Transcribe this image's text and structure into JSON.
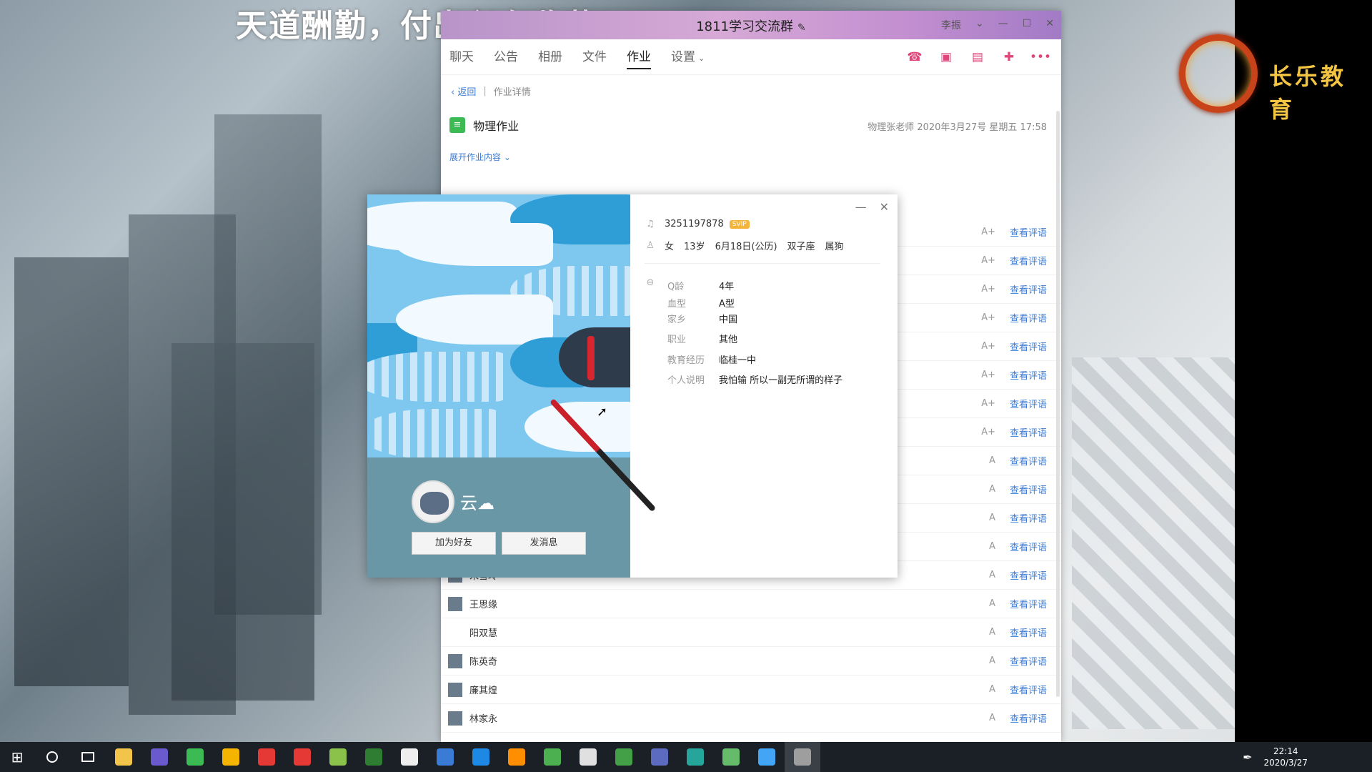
{
  "banner": "天道酬勤，付出必有收获！",
  "logo_text": "长乐教育",
  "window": {
    "title": "1811学习交流群",
    "title_right": "李振",
    "tabs": [
      "聊天",
      "公告",
      "相册",
      "文件",
      "作业",
      "设置"
    ],
    "active_tab": "作业",
    "action_icons": [
      "phone-icon",
      "video-icon",
      "lesson-icon",
      "screen-share-icon",
      "more-icon"
    ]
  },
  "breadcrumb": {
    "back": "返回",
    "current": "作业详情"
  },
  "homework": {
    "title": "物理作业",
    "meta": "物理张老师 2020年3月27号 星期五 17:58",
    "expand": "展开作业内容"
  },
  "rows": [
    {
      "name": "",
      "grade": "A+",
      "action": "查看评语",
      "avatar": false
    },
    {
      "name": "",
      "grade": "A+",
      "action": "查看评语",
      "avatar": false
    },
    {
      "name": "",
      "grade": "A+",
      "action": "查看评语",
      "avatar": false
    },
    {
      "name": "",
      "grade": "A+",
      "action": "查看评语",
      "avatar": false
    },
    {
      "name": "",
      "grade": "A+",
      "action": "查看评语",
      "avatar": false
    },
    {
      "name": "",
      "grade": "A+",
      "action": "查看评语",
      "avatar": false
    },
    {
      "name": "",
      "grade": "A+",
      "action": "查看评语",
      "avatar": false
    },
    {
      "name": "",
      "grade": "A+",
      "action": "查看评语",
      "avatar": false
    },
    {
      "name": "",
      "grade": "A",
      "action": "查看评语",
      "avatar": false
    },
    {
      "name": "",
      "grade": "A",
      "action": "查看评语",
      "avatar": false
    },
    {
      "name": "",
      "grade": "A",
      "action": "查看评语",
      "avatar": false
    },
    {
      "name": "",
      "grade": "A",
      "action": "查看评语",
      "avatar": false
    },
    {
      "name": "宋雪玲",
      "grade": "A",
      "action": "查看评语",
      "avatar": true
    },
    {
      "name": "王思缘",
      "grade": "A",
      "action": "查看评语",
      "avatar": true
    },
    {
      "name": "阳双慧",
      "grade": "A",
      "action": "查看评语",
      "avatar": false
    },
    {
      "name": "陈英奇",
      "grade": "A",
      "action": "查看评语",
      "avatar": true
    },
    {
      "name": "廉其煌",
      "grade": "A",
      "action": "查看评语",
      "avatar": true
    },
    {
      "name": "林家永",
      "grade": "A",
      "action": "查看评语",
      "avatar": true
    }
  ],
  "profile": {
    "qq": "3251197878",
    "badge": "SVIP",
    "gender": "女",
    "age": "13岁",
    "birthday": "6月18日(公历)",
    "zodiac": "双子座",
    "chinese_zodiac": "属狗",
    "nickname": "云☁",
    "add_friend": "加为好友",
    "send_msg": "发消息",
    "details": [
      {
        "k": "Q龄",
        "v": "4年"
      },
      {
        "k": "血型",
        "v": "A型"
      },
      {
        "k": "家乡",
        "v": "中国"
      },
      {
        "k": "职业",
        "v": "其他"
      },
      {
        "k": "教育经历",
        "v": "临桂一中"
      },
      {
        "k": "个人说明",
        "v": "我怕输 所以一副无所谓的样子"
      }
    ]
  },
  "taskbar": {
    "icons": [
      "explorer-icon",
      "app1-icon",
      "app2-icon",
      "app3-icon",
      "netease-icon",
      "qq-icon",
      "app4-icon",
      "app5-icon",
      "calculator-icon",
      "app6-icon",
      "photoshop-icon",
      "illustrator-icon",
      "wechat-icon",
      "app7-icon",
      "app8-icon",
      "app9-icon",
      "app10-icon",
      "app11-icon",
      "app12-icon",
      "qq-active-icon"
    ],
    "icon_colors": [
      "#f3c44a",
      "#6a5acd",
      "#3cba54",
      "#f4b400",
      "#e53935",
      "#e53935",
      "#8bc34a",
      "#2e7d32",
      "#eeeeee",
      "#3a7bd5",
      "#1e88e5",
      "#ff8f00",
      "#4caf50",
      "#e0e0e0",
      "#43a047",
      "#5c6bc0",
      "#26a69a",
      "#66bb6a",
      "#42a5f5",
      "#9e9e9e"
    ],
    "time": "22:14",
    "date": "2020/3/27"
  }
}
